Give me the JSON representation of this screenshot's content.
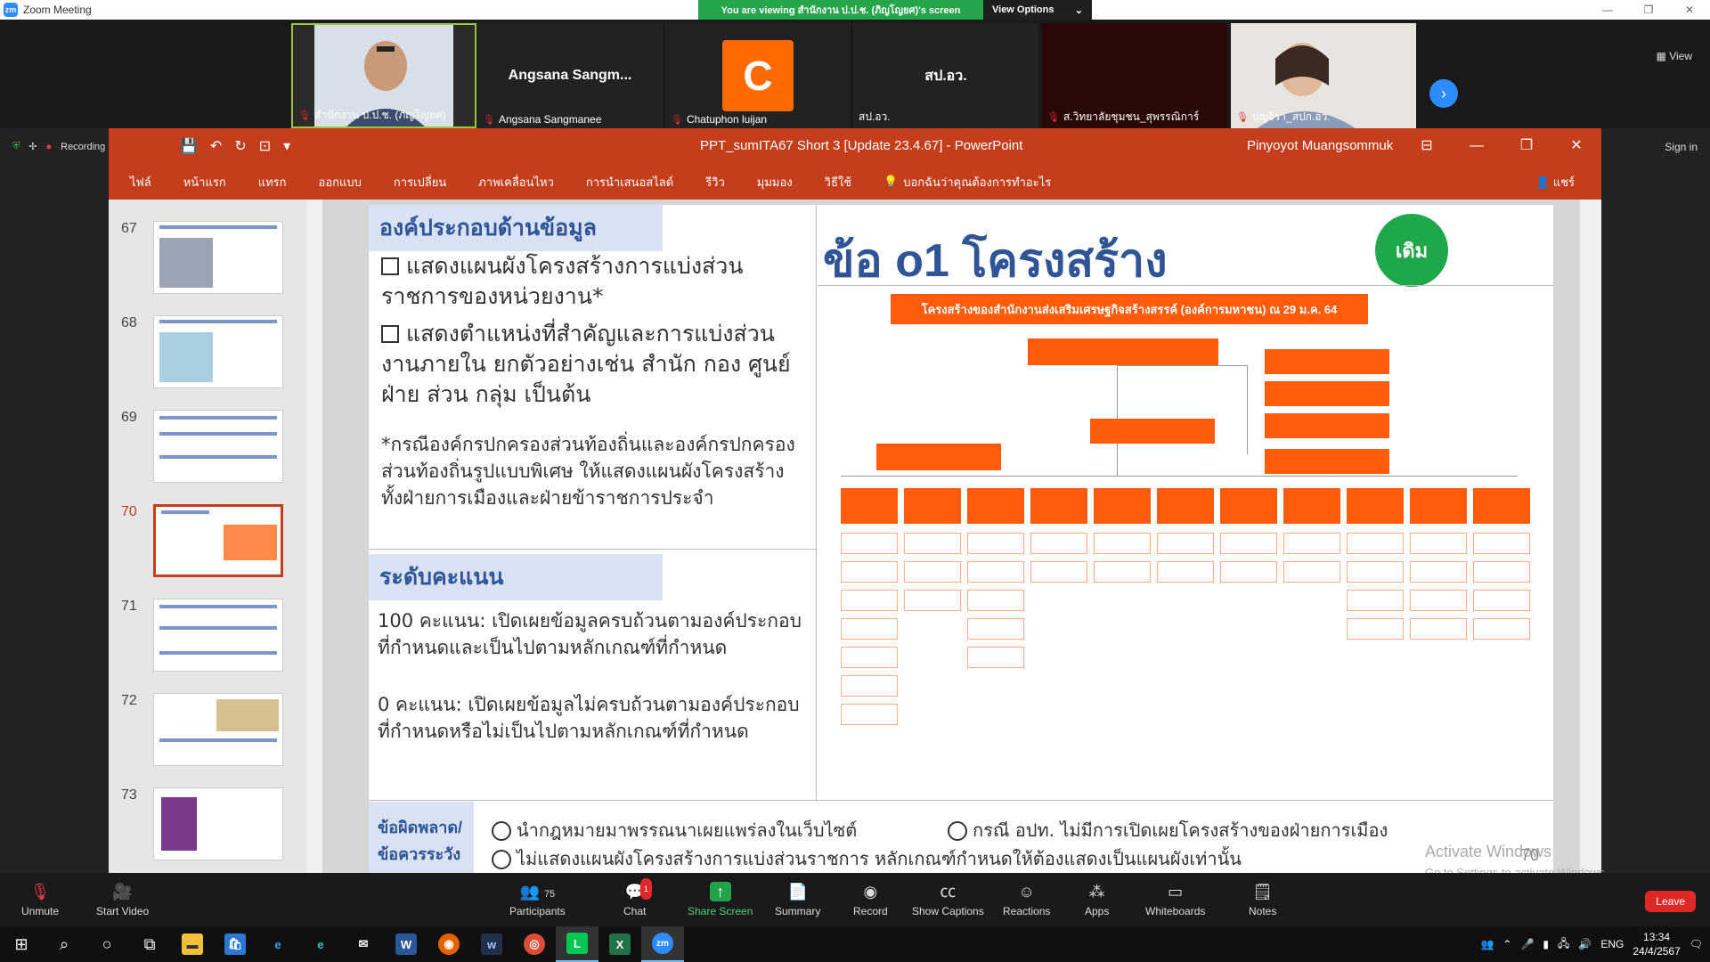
{
  "zoom": {
    "window_title": "Zoom Meeting",
    "viewing_text": "You are viewing สำนักงาน ป.ป.ช. (ภิญโญยศ)'s screen",
    "view_options": "View Options",
    "view_label": "View"
  },
  "participants": [
    {
      "name": "สำนักงาน ป.ป.ช. (ภิญโญยศ)",
      "display": "",
      "active": true
    },
    {
      "name": "Angsana Sangmanee",
      "display": "Angsana Sangm..."
    },
    {
      "name": "Chatuphon luijan",
      "display": "C"
    },
    {
      "name": "สป.อว.",
      "display": "สป.อว."
    },
    {
      "name": "ส.วิทยาลัยชุมชน_สุพรรณิการ์",
      "display": ""
    },
    {
      "name": "บุญจิรา_สปก.อว.",
      "display": ""
    }
  ],
  "ppt": {
    "file_title": "PPT_sumITA67 Short 3 [Update 23.4.67]  -  PowerPoint",
    "user": "Pinyoyot Muangsommuk",
    "sign_in": "Sign in",
    "recording": "Recording",
    "ribbon": [
      "ไฟล์",
      "หน้าแรก",
      "แทรก",
      "ออกแบบ",
      "การเปลี่ยน",
      "ภาพเคลื่อนไหว",
      "การนำเสนอสไลด์",
      "รีวิว",
      "มุมมอง",
      "วิธีใช้"
    ],
    "tell_me": "บอกฉันว่าคุณต้องการทำอะไร",
    "share": "แชร์",
    "thumbs": [
      {
        "num": "67",
        "selected": false
      },
      {
        "num": "68",
        "selected": false
      },
      {
        "num": "69",
        "selected": false
      },
      {
        "num": "70",
        "selected": true
      },
      {
        "num": "71",
        "selected": false
      },
      {
        "num": "72",
        "selected": false
      },
      {
        "num": "73",
        "selected": false
      }
    ]
  },
  "slide": {
    "sec1_title": "องค์ประกอบด้านข้อมูล",
    "item1": "แสดงแผนผังโครงสร้างการแบ่งส่วนราชการของหน่วยงาน*",
    "item2": "แสดงตำแหน่งที่สำคัญและการแบ่งส่วนงานภายใน ยกตัวอย่างเช่น สำนัก กอง ศูนย์ ฝ่าย ส่วน กลุ่ม เป็นต้น",
    "note": "*กรณีองค์กรปกครองส่วนท้องถิ่นและองค์กรปกครองส่วนท้องถิ่นรูปแบบพิเศษ ให้แสดงแผนผังโครงสร้าง ทั้งฝ่ายการเมืองและฝ่ายข้าราชการประจำ",
    "sec2_title": "ระดับคะแนน",
    "score100": "100 คะแนน: เปิดเผยข้อมูลครบถ้วนตามองค์ประกอบที่กำหนดและเป็นไปตามหลักเกณฑ์ที่กำหนด",
    "score0": "0 คะแนน: เปิดเผยข้อมูลไม่ครบถ้วนตามองค์ประกอบที่กำหนดหรือไม่เป็นไปตามหลักเกณฑ์ที่กำหนด",
    "main_title": "ข้อ o1 โครงสร้าง",
    "badge": "เดิม",
    "org_title": "โครงสร้างของสำนักงานส่งเสริมเศรษฐกิจสร้างสรรค์ (องค์การมหาชน) ณ 29 ม.ค. 64",
    "caution_title": "ข้อผิดพลาด/ข้อควรระวัง",
    "caution1": "นำกฎหมายมาพรรณนาเผยแพร่ลงในเว็บไซต์",
    "caution2": "กรณี อปท. ไม่มีการเปิดเผยโครงสร้างของฝ่ายการเมือง",
    "caution3": "ไม่แสดงแผนผังโครงสร้างการแบ่งส่วนราชการ หลักเกณฑ์กำหนดให้ต้องแสดงเป็นแผนผังเท่านั้น",
    "page_num": "70"
  },
  "watermark": {
    "line1": "Activate Windows",
    "line2": "Go to Settings to activate Windows."
  },
  "toolbar": {
    "unmute": "Unmute",
    "start_video": "Start Video",
    "participants": "Participants",
    "participants_count": "75",
    "chat": "Chat",
    "chat_badge": "1",
    "share": "Share Screen",
    "summary": "Summary",
    "record": "Record",
    "captions": "Show Captions",
    "reactions": "Reactions",
    "apps": "Apps",
    "whiteboards": "Whiteboards",
    "notes": "Notes",
    "leave": "Leave"
  },
  "taskbar": {
    "lang": "ENG",
    "time": "13:34",
    "date": "24/4/2567"
  }
}
